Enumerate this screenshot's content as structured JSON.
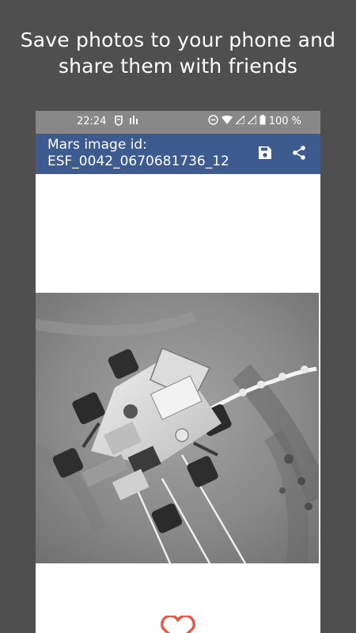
{
  "promo": {
    "line1": "Save photos to your phone and",
    "line2": "share them with friends"
  },
  "status_bar": {
    "time": "22:24",
    "battery": "100 %"
  },
  "app_bar": {
    "title_line1": "Mars image id:",
    "title_line2": "ESF_0042_0670681736_12",
    "save_icon": "save-icon",
    "share_icon": "share-icon"
  },
  "colors": {
    "background": "#4f4f4f",
    "status_bar": "#888888",
    "app_bar": "#3d5b8e",
    "heart": "#e25c4a"
  },
  "icons": {
    "favorite": "heart-outline-icon"
  }
}
